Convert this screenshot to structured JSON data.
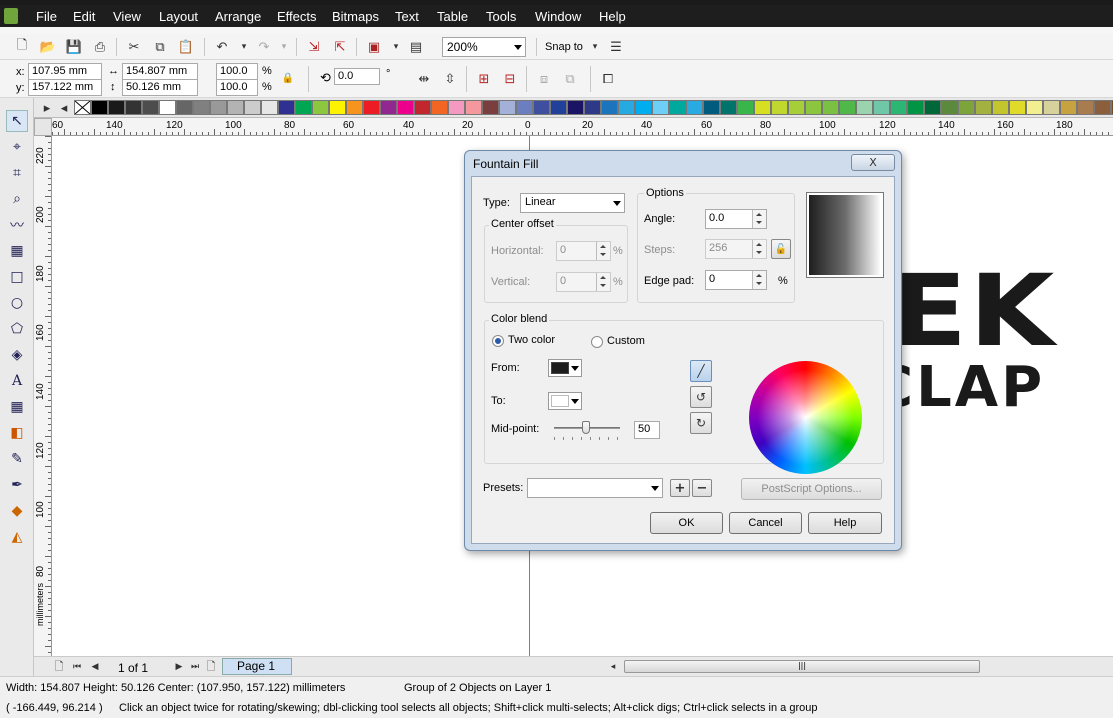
{
  "menu": [
    "File",
    "Edit",
    "View",
    "Layout",
    "Arrange",
    "Effects",
    "Bitmaps",
    "Text",
    "Table",
    "Tools",
    "Window",
    "Help"
  ],
  "toolbar": {
    "zoom": "200%",
    "snap_label": "Snap to"
  },
  "propbar": {
    "x_label": "x:",
    "x": "107.95 mm",
    "y_label": "y:",
    "y": "157.122 mm",
    "w": "154.807 mm",
    "h": "50.126 mm",
    "scale_x": "100.0",
    "scale_y": "100.0",
    "pct": "%",
    "rotation": "0.0",
    "deg": "°"
  },
  "palette_colors": [
    "#000000",
    "#1a1a1a",
    "#333333",
    "#4d4d4d",
    "#ffffff",
    "#666666",
    "#808080",
    "#999999",
    "#b3b3b3",
    "#cccccc",
    "#e6e6e6",
    "#2e3192",
    "#00a651",
    "#8dc63f",
    "#fff200",
    "#f7941d",
    "#ed1c24",
    "#92278f",
    "#ec008c",
    "#c1272d",
    "#f26522",
    "#f49ac1",
    "#f5989d",
    "#7a3e3e",
    "#a3b1d8",
    "#6b7fc0",
    "#3f4fa0",
    "#21409a",
    "#1b1464",
    "#2e3a87",
    "#1c75bc",
    "#27aae1",
    "#00aeef",
    "#6dcff6",
    "#00a99d",
    "#29abe2",
    "#005b7f",
    "#00746b",
    "#39b54a",
    "#d7df23",
    "#c0d72f",
    "#a6ce39",
    "#8cc63f",
    "#7ac143",
    "#50b848",
    "#9bd3ae",
    "#6fc7a8",
    "#2bb673",
    "#009444",
    "#006838",
    "#5b8a3c",
    "#7da33b",
    "#a2b13f",
    "#c2c52b",
    "#e0db2b",
    "#f3ef90",
    "#d7d19b",
    "#c6a33e",
    "#a97c50",
    "#8b5e3c",
    "#754c24"
  ],
  "ruler_h_labels": [
    "60",
    "140",
    "120",
    "100",
    "80",
    "60",
    "40",
    "20",
    "0",
    "20",
    "40",
    "60",
    "80",
    "100",
    "120",
    "140",
    "160",
    "180"
  ],
  "ruler_v_labels": [
    "220",
    "200",
    "180",
    "160",
    "140",
    "120",
    "100",
    "80"
  ],
  "ruler_unit": "millimeters",
  "page_nav": {
    "count": "1 of 1",
    "tab": "Page 1"
  },
  "artwork": {
    "line1": "EK",
    "line2": "CLAP"
  },
  "dialog": {
    "title": "Fountain Fill",
    "close": "X",
    "type_label": "Type:",
    "type_value": "Linear",
    "center_offset": "Center offset",
    "horizontal_label": "Horizontal:",
    "horizontal_value": "0",
    "vertical_label": "Vertical:",
    "vertical_value": "0",
    "pct": "%",
    "options": "Options",
    "angle_label": "Angle:",
    "angle_value": "0.0",
    "steps_label": "Steps:",
    "steps_value": "256",
    "edgepad_label": "Edge pad:",
    "edgepad_value": "0",
    "color_blend": "Color blend",
    "two_color": "Two color",
    "custom": "Custom",
    "from_label": "From:",
    "to_label": "To:",
    "from_color": "#1e1e1e",
    "to_color": "#ffffff",
    "midpoint_label": "Mid-point:",
    "midpoint_value": "50",
    "presets_label": "Presets:",
    "presets_value": "",
    "postscript": "PostScript Options...",
    "ok": "OK",
    "cancel": "Cancel",
    "help": "Help"
  },
  "status": {
    "line1": "Width: 154.807  Height: 50.126  Center: (107.950, 157.122)  millimeters",
    "layer": "Group of 2 Objects on Layer 1",
    "coords": "( -166.449, 96.214 )",
    "hint": "Click an object twice for rotating/skewing; dbl-clicking tool selects all objects; Shift+click multi-selects; Alt+click digs; Ctrl+click selects in a group"
  }
}
